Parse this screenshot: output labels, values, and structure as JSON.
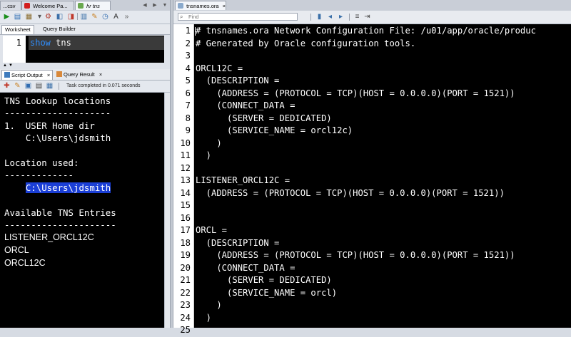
{
  "left": {
    "tabs": [
      {
        "label": "...csv",
        "icon": "file-icon"
      },
      {
        "label": "Welcome Pa...",
        "icon": "oracle-icon"
      },
      {
        "label": "hr tns",
        "icon": "sql-connection-icon"
      }
    ],
    "close_label": "×",
    "subtabs": {
      "worksheet": "Worksheet",
      "query_builder": "Query Builder"
    },
    "editor": {
      "line_number": "1",
      "keyword": "show",
      "rest": " tns"
    },
    "output_tabs": {
      "script_output": "Script Output",
      "query_result": "Query Result"
    },
    "status": "Task completed in 0.071 seconds",
    "output_lines": [
      "TNS Lookup locations",
      "--------------------",
      "1.  USER Home dir",
      "    C:\\Users\\jdsmith",
      "",
      "Location used:",
      "-------------",
      "    C:\\Users\\jdsmith",
      "",
      "Available TNS Entries",
      "---------------------",
      "LISTENER_ORCL12C",
      "ORCL",
      "ORCL12C"
    ]
  },
  "right": {
    "tab": {
      "label": "tnsnames.ora",
      "close": "×"
    },
    "find_placeholder": "Find",
    "code_lines": [
      {
        "n": "1",
        "text": "# tnsnames.ora Network Configuration File: /u01/app/oracle/produc"
      },
      {
        "n": "2",
        "text": "# Generated by Oracle configuration tools."
      },
      {
        "n": "3",
        "text": ""
      },
      {
        "n": "4",
        "text": "ORCL12C ="
      },
      {
        "n": "5",
        "text": "  (DESCRIPTION ="
      },
      {
        "n": "6",
        "text": "    (ADDRESS = (PROTOCOL = TCP)(HOST = 0.0.0.0)(PORT = 1521))"
      },
      {
        "n": "7",
        "text": "    (CONNECT_DATA ="
      },
      {
        "n": "8",
        "text": "      (SERVER = DEDICATED)"
      },
      {
        "n": "9",
        "text": "      (SERVICE_NAME = orcl12c)"
      },
      {
        "n": "10",
        "text": "    )"
      },
      {
        "n": "11",
        "text": "  )"
      },
      {
        "n": "12",
        "text": ""
      },
      {
        "n": "13",
        "text": "LISTENER_ORCL12C ="
      },
      {
        "n": "14",
        "text": "  (ADDRESS = (PROTOCOL = TCP)(HOST = 0.0.0.0)(PORT = 1521))"
      },
      {
        "n": "15",
        "text": ""
      },
      {
        "n": "16",
        "text": ""
      },
      {
        "n": "17",
        "text": "ORCL ="
      },
      {
        "n": "18",
        "text": "  (DESCRIPTION ="
      },
      {
        "n": "19",
        "text": "    (ADDRESS = (PROTOCOL = TCP)(HOST = 0.0.0.0)(PORT = 1521))"
      },
      {
        "n": "20",
        "text": "    (CONNECT_DATA ="
      },
      {
        "n": "21",
        "text": "      (SERVER = DEDICATED)"
      },
      {
        "n": "22",
        "text": "      (SERVICE_NAME = orcl)"
      },
      {
        "n": "23",
        "text": "    )"
      },
      {
        "n": "24",
        "text": "  )"
      },
      {
        "n": "25",
        "text": ""
      }
    ]
  },
  "colors": {
    "editor_bg": "#000000",
    "selection": "#1b3fd6",
    "keyword": "#2f8fff"
  }
}
